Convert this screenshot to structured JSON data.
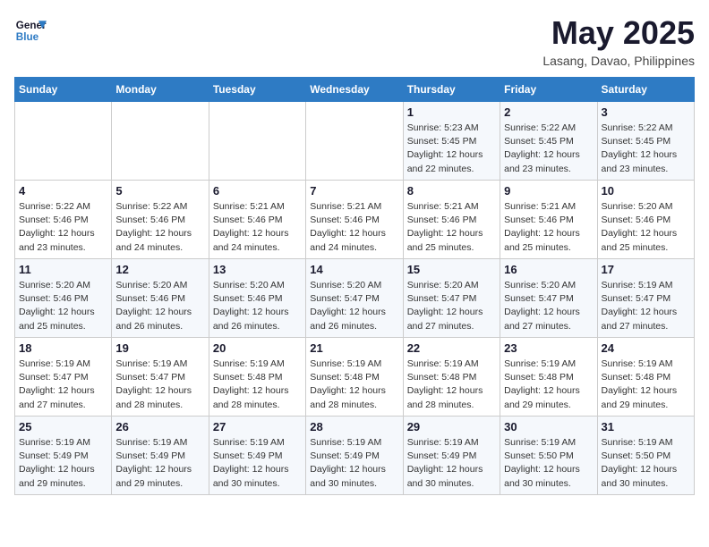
{
  "header": {
    "logo_line1": "General",
    "logo_line2": "Blue",
    "title": "May 2025",
    "subtitle": "Lasang, Davao, Philippines"
  },
  "days_of_week": [
    "Sunday",
    "Monday",
    "Tuesday",
    "Wednesday",
    "Thursday",
    "Friday",
    "Saturday"
  ],
  "weeks": [
    [
      {
        "day": "",
        "detail": ""
      },
      {
        "day": "",
        "detail": ""
      },
      {
        "day": "",
        "detail": ""
      },
      {
        "day": "",
        "detail": ""
      },
      {
        "day": "1",
        "detail": "Sunrise: 5:23 AM\nSunset: 5:45 PM\nDaylight: 12 hours\nand 22 minutes."
      },
      {
        "day": "2",
        "detail": "Sunrise: 5:22 AM\nSunset: 5:45 PM\nDaylight: 12 hours\nand 23 minutes."
      },
      {
        "day": "3",
        "detail": "Sunrise: 5:22 AM\nSunset: 5:45 PM\nDaylight: 12 hours\nand 23 minutes."
      }
    ],
    [
      {
        "day": "4",
        "detail": "Sunrise: 5:22 AM\nSunset: 5:46 PM\nDaylight: 12 hours\nand 23 minutes."
      },
      {
        "day": "5",
        "detail": "Sunrise: 5:22 AM\nSunset: 5:46 PM\nDaylight: 12 hours\nand 24 minutes."
      },
      {
        "day": "6",
        "detail": "Sunrise: 5:21 AM\nSunset: 5:46 PM\nDaylight: 12 hours\nand 24 minutes."
      },
      {
        "day": "7",
        "detail": "Sunrise: 5:21 AM\nSunset: 5:46 PM\nDaylight: 12 hours\nand 24 minutes."
      },
      {
        "day": "8",
        "detail": "Sunrise: 5:21 AM\nSunset: 5:46 PM\nDaylight: 12 hours\nand 25 minutes."
      },
      {
        "day": "9",
        "detail": "Sunrise: 5:21 AM\nSunset: 5:46 PM\nDaylight: 12 hours\nand 25 minutes."
      },
      {
        "day": "10",
        "detail": "Sunrise: 5:20 AM\nSunset: 5:46 PM\nDaylight: 12 hours\nand 25 minutes."
      }
    ],
    [
      {
        "day": "11",
        "detail": "Sunrise: 5:20 AM\nSunset: 5:46 PM\nDaylight: 12 hours\nand 25 minutes."
      },
      {
        "day": "12",
        "detail": "Sunrise: 5:20 AM\nSunset: 5:46 PM\nDaylight: 12 hours\nand 26 minutes."
      },
      {
        "day": "13",
        "detail": "Sunrise: 5:20 AM\nSunset: 5:46 PM\nDaylight: 12 hours\nand 26 minutes."
      },
      {
        "day": "14",
        "detail": "Sunrise: 5:20 AM\nSunset: 5:47 PM\nDaylight: 12 hours\nand 26 minutes."
      },
      {
        "day": "15",
        "detail": "Sunrise: 5:20 AM\nSunset: 5:47 PM\nDaylight: 12 hours\nand 27 minutes."
      },
      {
        "day": "16",
        "detail": "Sunrise: 5:20 AM\nSunset: 5:47 PM\nDaylight: 12 hours\nand 27 minutes."
      },
      {
        "day": "17",
        "detail": "Sunrise: 5:19 AM\nSunset: 5:47 PM\nDaylight: 12 hours\nand 27 minutes."
      }
    ],
    [
      {
        "day": "18",
        "detail": "Sunrise: 5:19 AM\nSunset: 5:47 PM\nDaylight: 12 hours\nand 27 minutes."
      },
      {
        "day": "19",
        "detail": "Sunrise: 5:19 AM\nSunset: 5:47 PM\nDaylight: 12 hours\nand 28 minutes."
      },
      {
        "day": "20",
        "detail": "Sunrise: 5:19 AM\nSunset: 5:48 PM\nDaylight: 12 hours\nand 28 minutes."
      },
      {
        "day": "21",
        "detail": "Sunrise: 5:19 AM\nSunset: 5:48 PM\nDaylight: 12 hours\nand 28 minutes."
      },
      {
        "day": "22",
        "detail": "Sunrise: 5:19 AM\nSunset: 5:48 PM\nDaylight: 12 hours\nand 28 minutes."
      },
      {
        "day": "23",
        "detail": "Sunrise: 5:19 AM\nSunset: 5:48 PM\nDaylight: 12 hours\nand 29 minutes."
      },
      {
        "day": "24",
        "detail": "Sunrise: 5:19 AM\nSunset: 5:48 PM\nDaylight: 12 hours\nand 29 minutes."
      }
    ],
    [
      {
        "day": "25",
        "detail": "Sunrise: 5:19 AM\nSunset: 5:49 PM\nDaylight: 12 hours\nand 29 minutes."
      },
      {
        "day": "26",
        "detail": "Sunrise: 5:19 AM\nSunset: 5:49 PM\nDaylight: 12 hours\nand 29 minutes."
      },
      {
        "day": "27",
        "detail": "Sunrise: 5:19 AM\nSunset: 5:49 PM\nDaylight: 12 hours\nand 30 minutes."
      },
      {
        "day": "28",
        "detail": "Sunrise: 5:19 AM\nSunset: 5:49 PM\nDaylight: 12 hours\nand 30 minutes."
      },
      {
        "day": "29",
        "detail": "Sunrise: 5:19 AM\nSunset: 5:49 PM\nDaylight: 12 hours\nand 30 minutes."
      },
      {
        "day": "30",
        "detail": "Sunrise: 5:19 AM\nSunset: 5:50 PM\nDaylight: 12 hours\nand 30 minutes."
      },
      {
        "day": "31",
        "detail": "Sunrise: 5:19 AM\nSunset: 5:50 PM\nDaylight: 12 hours\nand 30 minutes."
      }
    ]
  ]
}
